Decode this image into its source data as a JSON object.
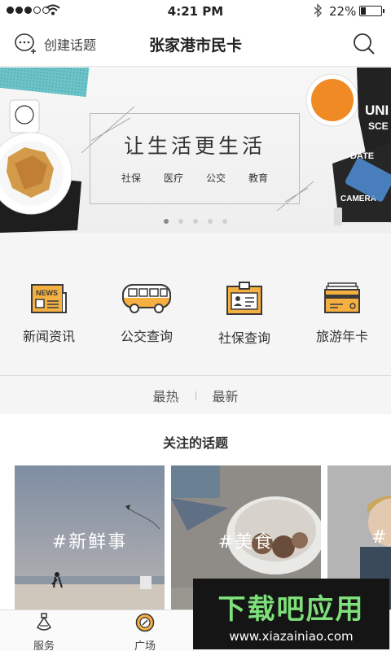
{
  "status_bar": {
    "time": "4:21 PM",
    "battery_text": "22%",
    "battery_level": 0.22
  },
  "navbar": {
    "create_topic_label": "创建话题",
    "title": "张家港市民卡"
  },
  "banner": {
    "slogan": "让生活更生活",
    "tags": [
      "社保",
      "医疗",
      "公交",
      "教育"
    ],
    "slide_count": 5,
    "active_slide": 1
  },
  "services": [
    {
      "label": "新闻资讯",
      "icon": "news-icon"
    },
    {
      "label": "公交查询",
      "icon": "bus-icon"
    },
    {
      "label": "社保查询",
      "icon": "id-card-icon"
    },
    {
      "label": "旅游年卡",
      "icon": "travel-card-icon"
    }
  ],
  "sort_tabs": [
    "最热",
    "最新"
  ],
  "topics": {
    "heading": "关注的话题",
    "cards": [
      {
        "tag": "#新鲜事"
      },
      {
        "tag": "#美食"
      },
      {
        "tag": "#"
      }
    ]
  },
  "tabbar": {
    "tabs": [
      {
        "label": "服务",
        "icon": "perfume-bottle-icon"
      },
      {
        "label": "广场",
        "icon": "compass-icon"
      }
    ]
  },
  "watermark": {
    "brand": "下载吧应用",
    "url": "www.xiazainiao.com"
  },
  "colors": {
    "accent_orange": "#f5b041",
    "icon_dark": "#3a3a3a",
    "watermark_green": "#7ee07a"
  }
}
